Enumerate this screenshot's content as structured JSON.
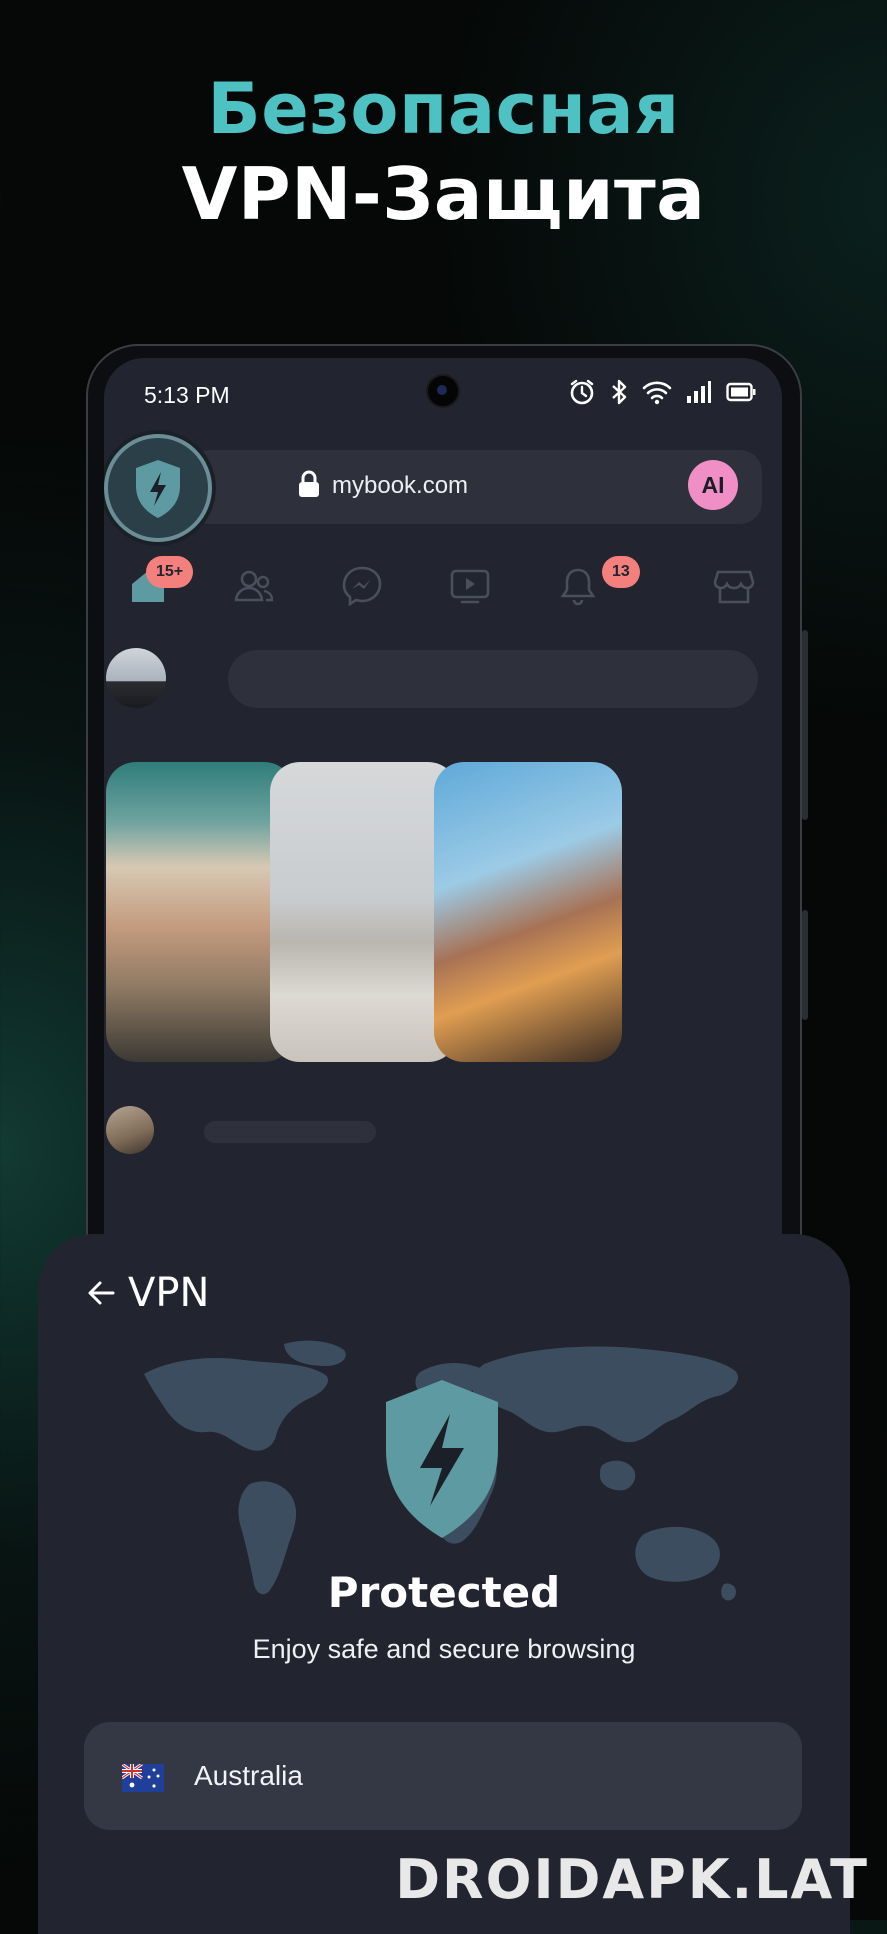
{
  "promo": {
    "line1": "Безопасная",
    "line2": "VPN-Защита"
  },
  "status_bar": {
    "time": "5:13 PM"
  },
  "address_bar": {
    "url": "mybook.com",
    "ai_label": "AI"
  },
  "nav": {
    "home_badge": "15+",
    "notifications_badge": "13"
  },
  "vpn_sheet": {
    "title": "VPN",
    "status": "Protected",
    "subtitle": "Enjoy safe and secure browsing",
    "country": "Australia"
  },
  "watermark": "DROIDAPK.LAT",
  "colors": {
    "accent_teal": "#4ec2c2",
    "shield": "#5e9aa2",
    "badge": "#f4807e",
    "ai_pink": "#ef8fc6"
  }
}
